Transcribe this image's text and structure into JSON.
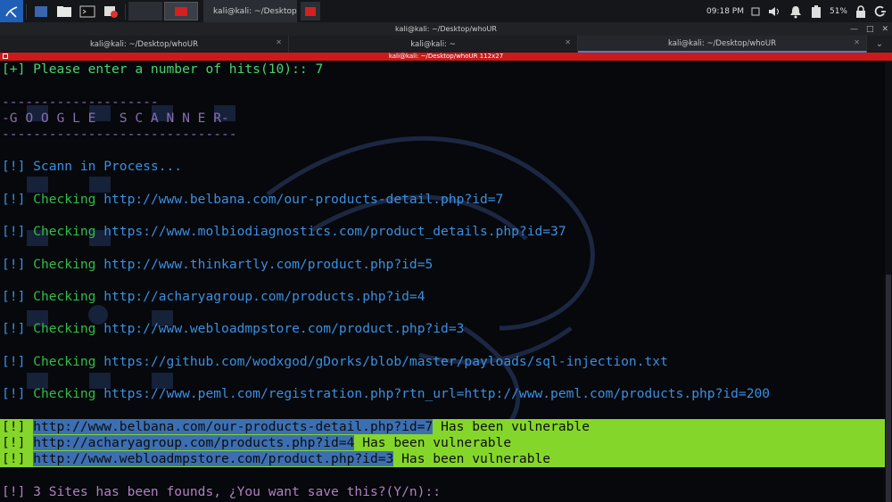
{
  "taskbar": {
    "clock": "09:18 PM",
    "battery": "51%",
    "window_button": "kali@kali: ~/Desktop/wh..."
  },
  "window": {
    "title": "kali@kali: ~/Desktop/whoUR"
  },
  "tabs": [
    {
      "label": "kali@kali: ~/Desktop/whoUR",
      "active": false
    },
    {
      "label": "kali@kali: ~",
      "active": false
    },
    {
      "label": "kali@kali: ~/Desktop/whoUR",
      "active": true
    }
  ],
  "pane": {
    "title": "kali@kali: ~/Desktop/whoUR 112x27"
  },
  "terminal": {
    "prompt_hits": "[+] Please enter a number of hits(10):: 7",
    "dash_top": "--------------------",
    "banner": "-G O O G L E   S C A N N E R-",
    "dash_bottom": "------------------------------",
    "scan_status": "[!] Scann in Process...",
    "checking_prefix": "[!] Checking",
    "checks": [
      "http://www.belbana.com/our-products-detail.php?id=7",
      "https://www.molbiodiagnostics.com/product_details.php?id=37",
      "http://www.thinkartly.com/product.php?id=5",
      "http://acharyagroup.com/products.php?id=4",
      "http://www.webloadmpstore.com/product.php?id=3",
      "https://github.com/wodxgod/gDorks/blob/master/payloads/sql-injection.txt",
      "https://www.peml.com/registration.php?rtn_url=http://www.peml.com/products.php?id=200"
    ],
    "vuln_prefix": "[!]",
    "vuln_suffix": "Has been vulnerable",
    "vulnerable": [
      "http://www.belbana.com/our-products-detail.php?id=7",
      "http://acharyagroup.com/products.php?id=4",
      "http://www.webloadmpstore.com/product.php?id=3"
    ],
    "save_prompt": "[!] 3 Sites has been founds, ¿You want save this?(Y/n)::"
  },
  "colors": {
    "green": "#49d46a",
    "blue": "#3b8fe0",
    "purple": "#b07fc0",
    "highlight": "#85d62a",
    "pane_bar": "#cc1a1a"
  }
}
